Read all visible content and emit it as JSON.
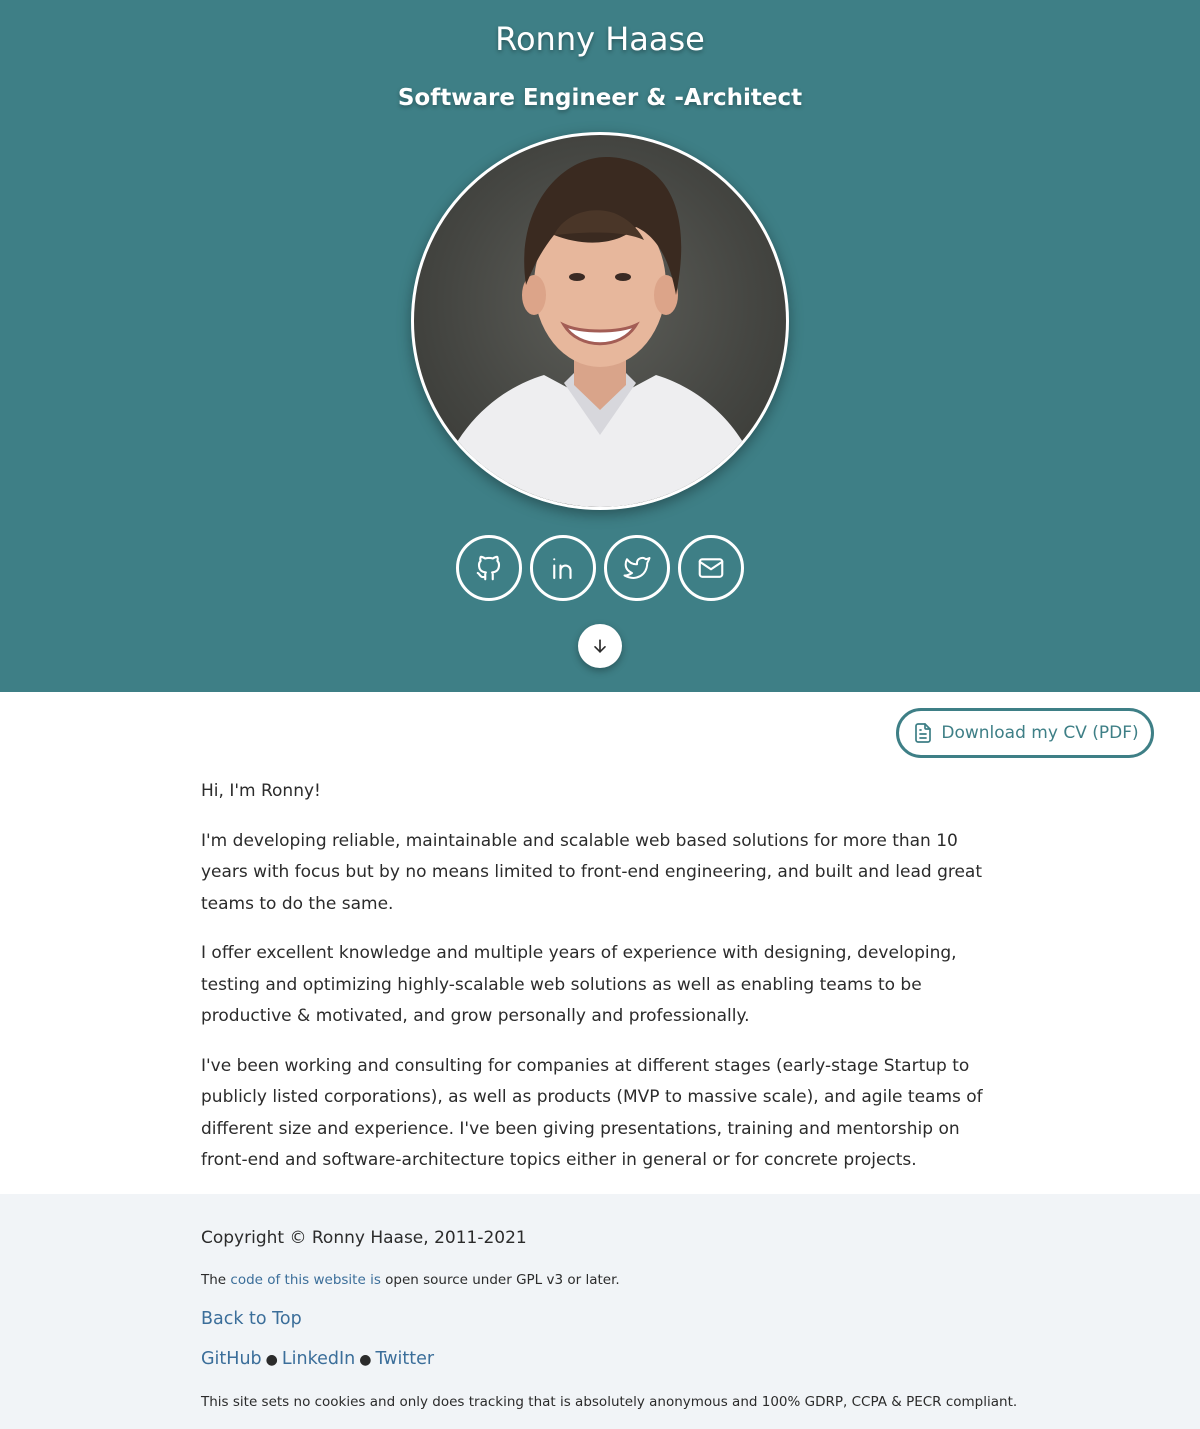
{
  "header": {
    "name": "Ronny Haase",
    "role": "Software Engineer & -Architect",
    "portrait_alt": "Portrait photo",
    "socials": [
      {
        "name": "GitHub",
        "icon": "github-icon"
      },
      {
        "name": "LinkedIn",
        "icon": "linkedin-icon"
      },
      {
        "name": "Twitter",
        "icon": "twitter-icon"
      },
      {
        "name": "Email",
        "icon": "mail-icon"
      }
    ],
    "scroll_icon": "arrow-down-icon"
  },
  "cv_button": {
    "label": "Download my CV (PDF)",
    "icon": "document-icon"
  },
  "about": {
    "greeting": "Hi, I'm Ronny!",
    "paragraphs": [
      "I'm developing reliable, maintainable and scalable web based solutions for more than 10 years with focus but by no means limited to front-end engineering, and built and lead great teams to do the same.",
      "I offer excellent knowledge and multiple years of experience with designing, developing, testing and optimizing highly-scalable web solutions as well as enabling teams to be productive & motivated, and grow personally and professionally.",
      "I've been working and consulting for companies at different stages (early-stage Startup to publicly listed corporations), as well as products (MVP to massive scale), and agile teams of different size and experience. I've been giving presentations, training and mentorship on front-end and software-architecture topics either in general or for concrete projects."
    ]
  },
  "footer": {
    "copyright": "Copyright © Ronny Haase, 2011-2021",
    "license_prefix": "The ",
    "license_link": "code of this website is",
    "license_suffix": " open source under GPL v3 or later.",
    "back_to_top": "Back to Top",
    "links": [
      "GitHub",
      "LinkedIn",
      "Twitter"
    ],
    "separator": "●",
    "privacy": "This site sets no cookies and only does tracking that is absolutely anonymous and 100% GDRP, CCPA & PECR compliant."
  },
  "colors": {
    "brand_teal": "#3e7f86",
    "link_blue": "#3b6e9a",
    "footer_bg": "#f1f4f7"
  }
}
